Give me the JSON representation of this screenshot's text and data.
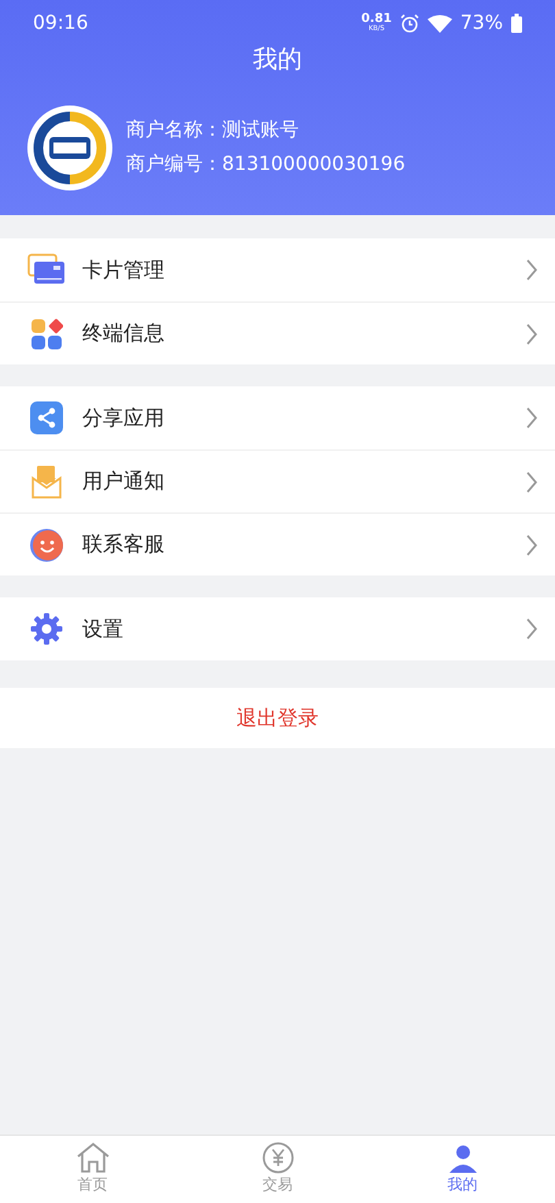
{
  "status_bar": {
    "time": "09:16",
    "speed": "0.81",
    "speed_unit": "KB/S",
    "battery": "73%"
  },
  "title": "我的",
  "merchant": {
    "name_label": "商户名称：",
    "name": "测试账号",
    "id_label": "商户编号：",
    "id": "813100000030196"
  },
  "menu_groups": [
    {
      "items": [
        {
          "kind": "card",
          "label": "卡片管理"
        },
        {
          "kind": "terminal",
          "label": "终端信息"
        }
      ]
    },
    {
      "items": [
        {
          "kind": "share",
          "label": "分享应用"
        },
        {
          "kind": "notice",
          "label": "用户通知"
        },
        {
          "kind": "service",
          "label": "联系客服"
        }
      ]
    },
    {
      "items": [
        {
          "kind": "settings",
          "label": "设置"
        }
      ]
    }
  ],
  "logout": "退出登录",
  "bottom_nav": [
    {
      "kind": "home",
      "label": "首页",
      "selected": false
    },
    {
      "kind": "trade",
      "label": "交易",
      "selected": false
    },
    {
      "kind": "me",
      "label": "我的",
      "selected": true
    }
  ]
}
